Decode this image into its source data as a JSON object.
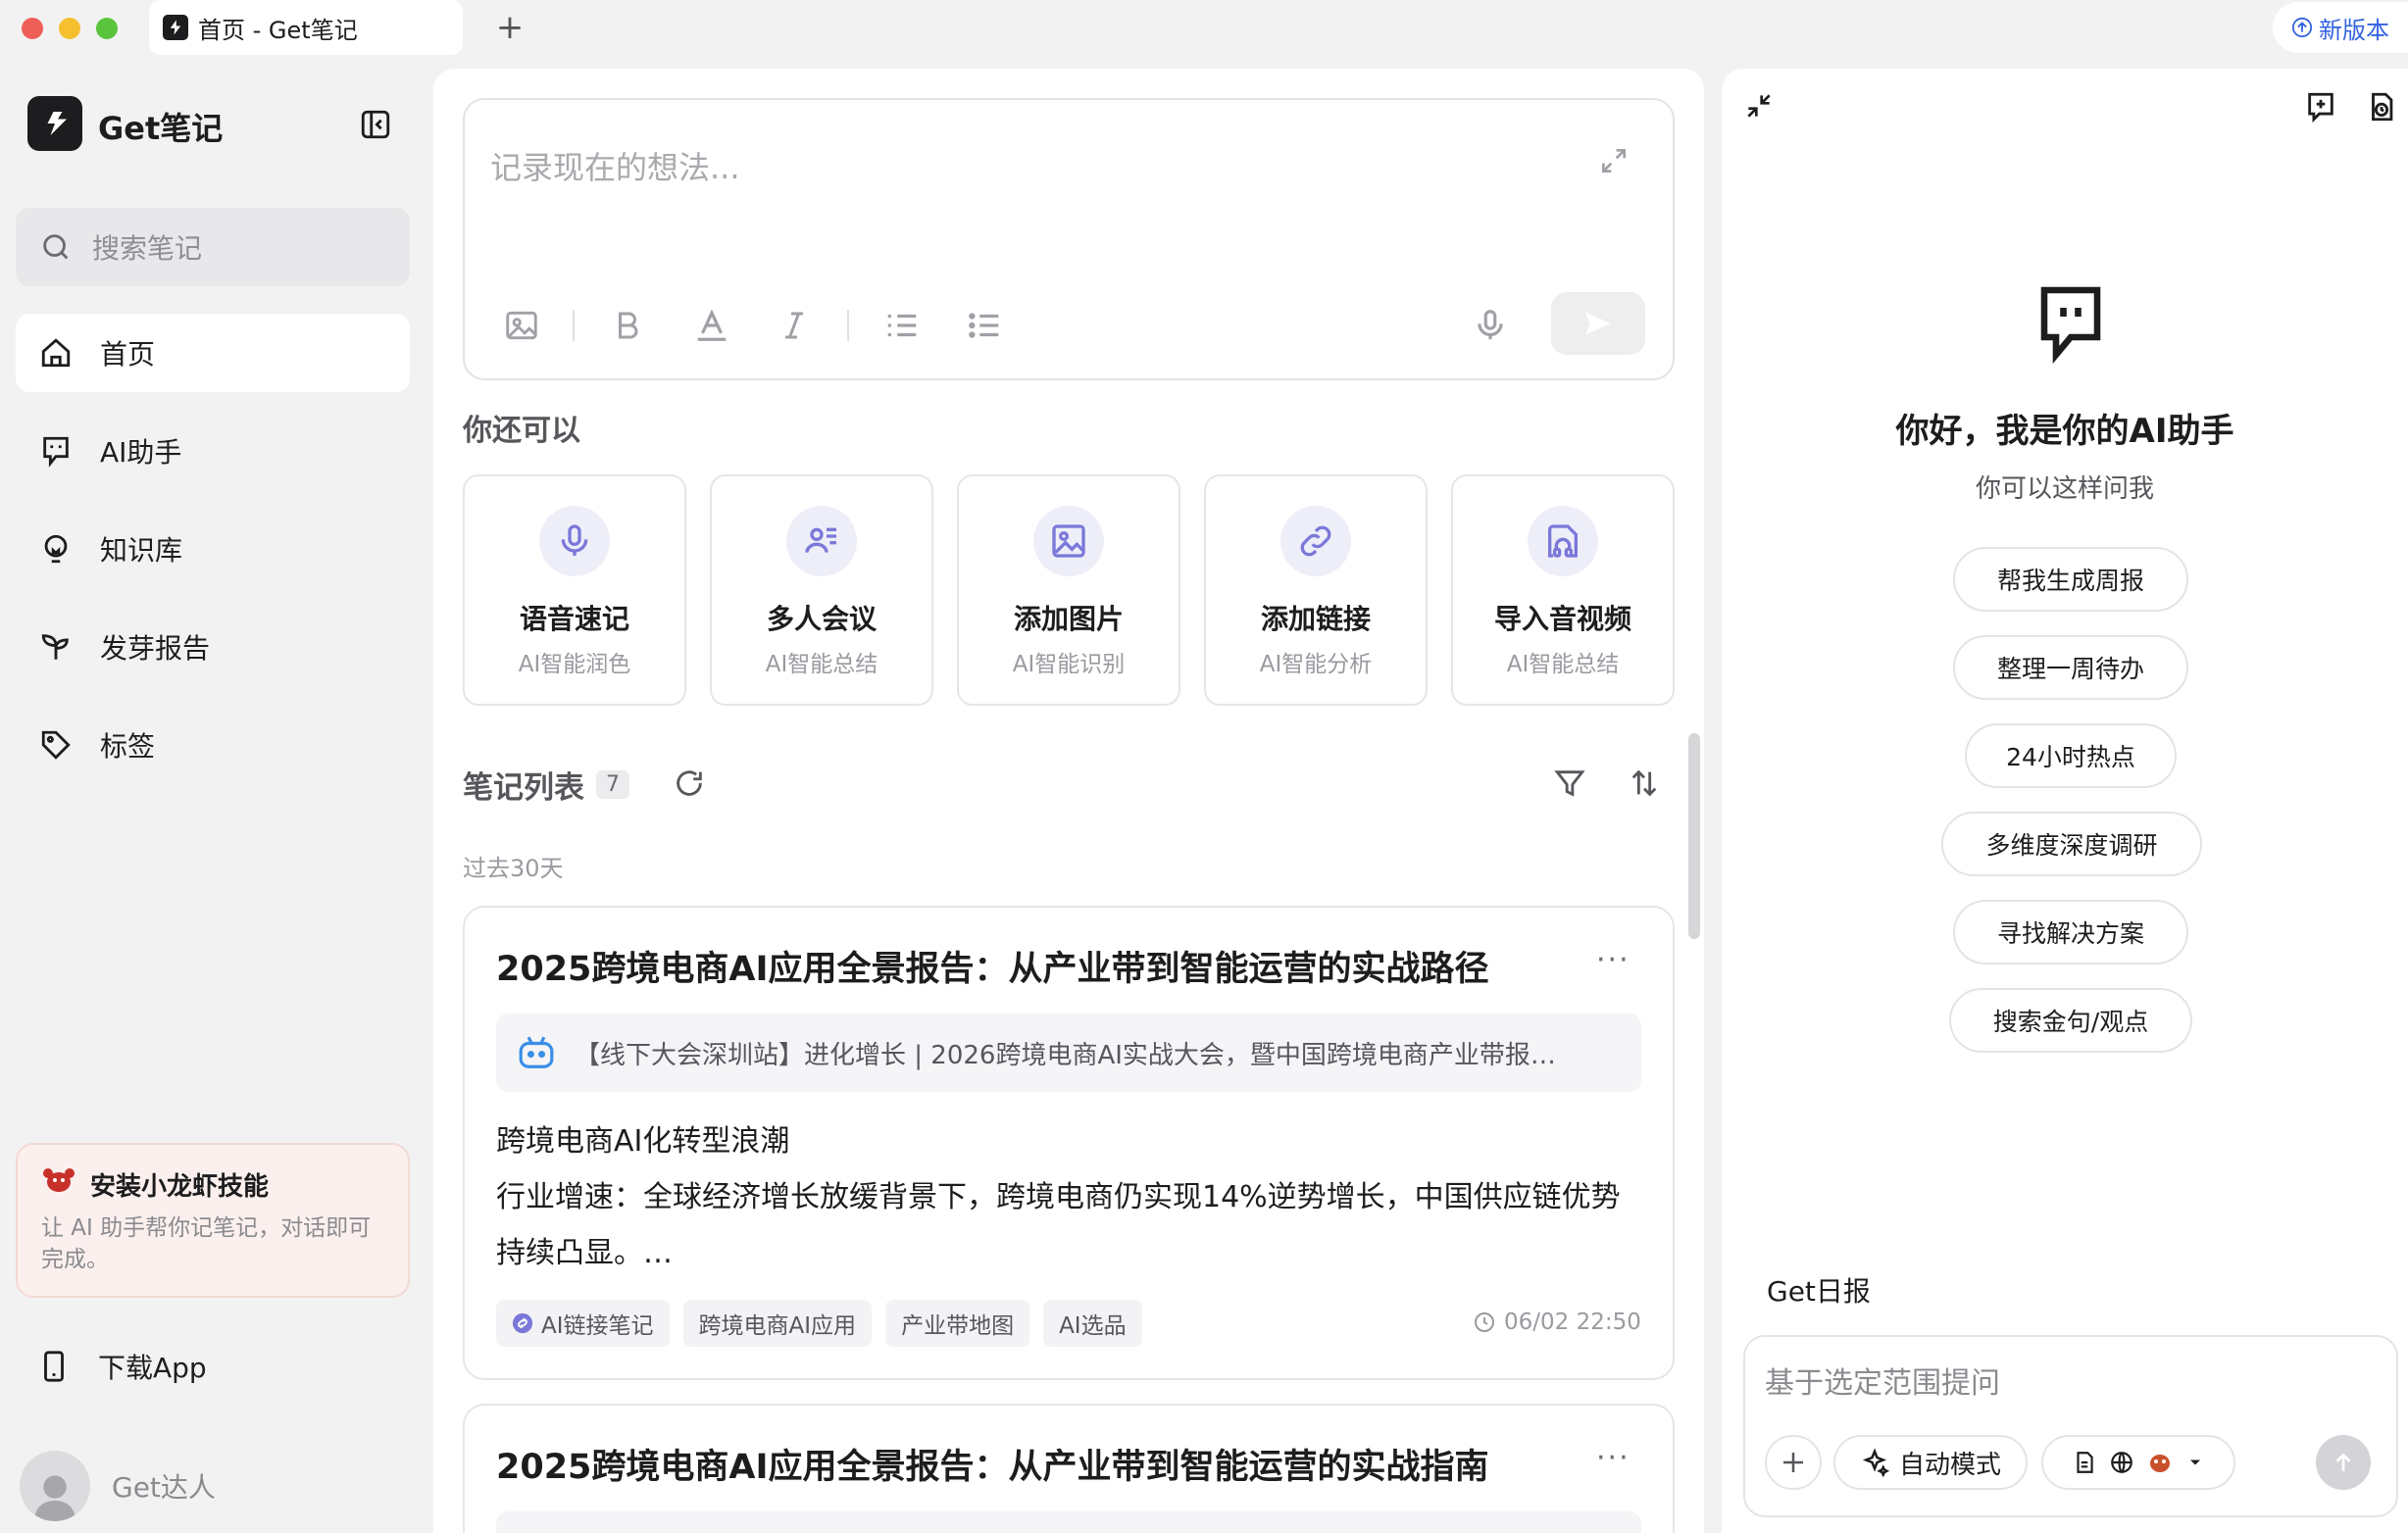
{
  "window": {
    "tab_title": "首页 - Get笔记",
    "new_tab": "+",
    "update_label": "新版本",
    "traffic_colors": [
      "#ee5f57",
      "#f5bf2e",
      "#5ac43c"
    ]
  },
  "sidebar": {
    "app_name": "Get笔记",
    "search_placeholder": "搜索笔记",
    "items": [
      {
        "label": "首页",
        "icon": "home-icon",
        "active": true
      },
      {
        "label": "AI助手",
        "icon": "ai-assistant-icon"
      },
      {
        "label": "知识库",
        "icon": "bulb-icon"
      },
      {
        "label": "发芽报告",
        "icon": "sprout-icon"
      },
      {
        "label": "标签",
        "icon": "tag-icon"
      }
    ],
    "promo": {
      "title": "安装小龙虾技能",
      "desc": "让 AI 助手帮你记笔记，对话即可完成。"
    },
    "download": "下载App",
    "user_name": "Get达人"
  },
  "editor": {
    "placeholder": "记录现在的想法..."
  },
  "quick": {
    "title": "你还可以",
    "cards": [
      {
        "title": "语音速记",
        "sub": "AI智能润色",
        "icon": "mic-icon"
      },
      {
        "title": "多人会议",
        "sub": "AI智能总结",
        "icon": "meeting-icon"
      },
      {
        "title": "添加图片",
        "sub": "AI智能识别",
        "icon": "image-icon"
      },
      {
        "title": "添加链接",
        "sub": "AI智能分析",
        "icon": "link-icon"
      },
      {
        "title": "导入音视频",
        "sub": "AI智能总结",
        "icon": "audio-video-icon"
      }
    ]
  },
  "notes": {
    "title": "笔记列表",
    "count": "7",
    "period": "过去30天",
    "items": [
      {
        "title": "2025跨境电商AI应用全景报告：从产业带到智能运营的实战路径",
        "source": "【线下大会深圳站】进化增长 | 2026跨境电商AI实战大会，暨中国跨境电商产业带报…",
        "body_line1": "跨境电商AI化转型浪潮",
        "body_line2": "行业增速：全球经济增长放缓背景下，跨境电商仍实现14%逆势增长，中国供应链优势持续凸显。…",
        "tags": [
          "AI链接笔记",
          "跨境电商AI应用",
          "产业带地图",
          "AI选品"
        ],
        "time": "06/02 22:50"
      },
      {
        "title": "2025跨境电商AI应用全景报告：从产业带到智能运营的实战指南"
      }
    ]
  },
  "assistant": {
    "greeting": "你好，我是你的AI助手",
    "subtitle": "你可以这样问我",
    "suggestions": [
      "帮我生成周报",
      "整理一周待办",
      "24小时热点",
      "多维度深度调研",
      "寻找解决方案",
      "搜索金句/观点"
    ],
    "daily": "Get日报",
    "ask_placeholder": "基于选定范围提问",
    "mode": "自动模式"
  }
}
